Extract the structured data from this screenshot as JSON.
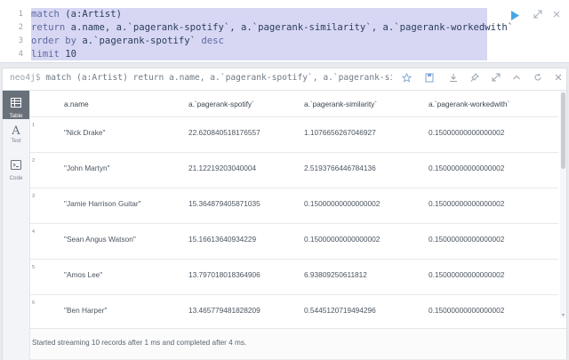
{
  "editor": {
    "lines": [
      {
        "number": "1",
        "segments": [
          {
            "t": "match",
            "c": "kw"
          },
          {
            "t": " (a:Artist)",
            "c": "tx"
          }
        ]
      },
      {
        "number": "2",
        "segments": [
          {
            "t": "return",
            "c": "kw"
          },
          {
            "t": " a.name, a.`pagerank-spotify`, a.`pagerank-similarity`, a.`pagerank-workedwith`",
            "c": "tx"
          }
        ]
      },
      {
        "number": "3",
        "segments": [
          {
            "t": "order",
            "c": "kw"
          },
          {
            "t": " ",
            "c": "tx"
          },
          {
            "t": "by",
            "c": "kw"
          },
          {
            "t": " a.`pagerank-spotify` ",
            "c": "tx"
          },
          {
            "t": "desc",
            "c": "kw"
          }
        ]
      },
      {
        "number": "4",
        "segments": [
          {
            "t": "limit",
            "c": "kw"
          },
          {
            "t": " 10",
            "c": "tx"
          }
        ]
      }
    ],
    "icons": [
      "play-icon",
      "expand-icon",
      "close-icon"
    ]
  },
  "frame": {
    "prompt": "neo4j$",
    "query": " match (a:Artist) return a.name, a.`pagerank-spotify`, a.`pagerank-simil…",
    "header_icons": [
      "star-icon",
      "save-icon",
      "download-icon",
      "pin-icon",
      "fullscreen-icon",
      "collapse-icon",
      "refresh-icon",
      "close-icon"
    ]
  },
  "sidebar": {
    "items": [
      {
        "label": "Table",
        "icon": "table-icon",
        "active": true
      },
      {
        "label": "Text",
        "icon": "text-icon",
        "active": false
      },
      {
        "label": "Code",
        "icon": "code-icon",
        "active": false
      }
    ]
  },
  "table": {
    "columns": [
      "a.name",
      "a.`pagerank-spotify`",
      "a.`pagerank-similarity`",
      "a.`pagerank-workedwith`"
    ],
    "rows": [
      {
        "n": "1",
        "cells": [
          "\"Nick Drake\"",
          "22.620840518176557",
          "1.1076656267046927",
          "0.15000000000000002"
        ]
      },
      {
        "n": "2",
        "cells": [
          "\"John Martyn\"",
          "21.12219203040004",
          "2.5193766446784136",
          "0.15000000000000002"
        ]
      },
      {
        "n": "3",
        "cells": [
          "\"Jamie Harrison Guitar\"",
          "15.364879405871035",
          "0.15000000000000002",
          "0.15000000000000002"
        ]
      },
      {
        "n": "4",
        "cells": [
          "\"Sean Angus Watson\"",
          "15.16613640934229",
          "0.15000000000000002",
          "0.15000000000000002"
        ]
      },
      {
        "n": "5",
        "cells": [
          "\"Amos Lee\"",
          "13.797018018364906",
          "6.93809250611812",
          "0.15000000000000002"
        ]
      },
      {
        "n": "6",
        "cells": [
          "\"Ben Harper\"",
          "13.465779481828209",
          "0.5445120719494296",
          "0.15000000000000002"
        ]
      }
    ]
  },
  "status": {
    "message": "Started streaming 10 records after 1 ms and completed after 4 ms."
  }
}
